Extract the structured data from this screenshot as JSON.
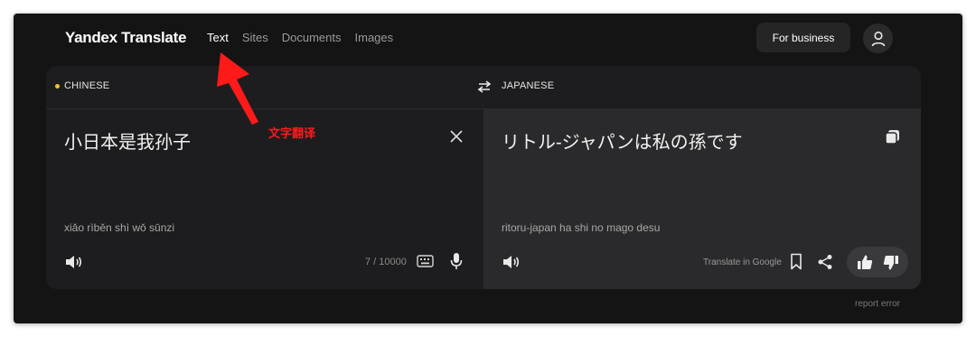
{
  "header": {
    "logo": "Yandex Translate",
    "nav": [
      "Text",
      "Sites",
      "Documents",
      "Images"
    ],
    "active_tab": "Text",
    "business_button": "For business"
  },
  "languages": {
    "source": "CHINESE",
    "target": "JAPANESE"
  },
  "source": {
    "text": "小日本是我孙子",
    "transliteration": "xiǎo rìběn shì wǒ sūnzi",
    "counter": "7 / 10000"
  },
  "target": {
    "text": "リトル-ジャパンは私の孫です",
    "transliteration": "ritoru-japan ha shi no mago desu",
    "translate_in_google": "Translate in Google"
  },
  "footer": {
    "report": "report error"
  },
  "annotation": {
    "label": "文字翻译",
    "color": "#ff1a1a"
  },
  "colors": {
    "accent_dot": "#f2c230",
    "background": "#141414",
    "panel": "#1d1d1f",
    "panel_right": "#2a2a2c"
  },
  "icons": [
    "user-icon",
    "swap-icon",
    "clear-icon",
    "copy-icon",
    "speaker-icon",
    "keyboard-icon",
    "microphone-icon",
    "bookmark-icon",
    "share-icon",
    "thumbs-up-icon",
    "thumbs-down-icon"
  ]
}
